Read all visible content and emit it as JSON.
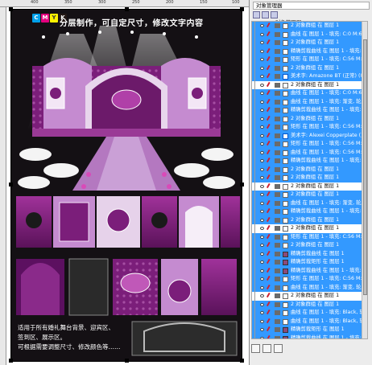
{
  "ruler": {
    "ticks": [
      "400",
      "350",
      "300",
      "250",
      "200",
      "150",
      "100"
    ]
  },
  "canvas": {
    "header_title": "分层制作，可自定尺寸，修改文字内容",
    "cmyk_letters": [
      "C",
      "M",
      "Y",
      "K"
    ],
    "cmyk_colors": [
      "#00a0e9",
      "#e4007f",
      "#fff100",
      "#231815"
    ],
    "info_lines": [
      "适用于所有婚礼舞台背景、迎宾区、",
      "签到区、展示区。",
      "可根据需要调整尺寸、修改颜色等……"
    ],
    "accent_purple": "#7b1e7a",
    "accent_lavender": "#c58bd0"
  },
  "docker": {
    "tab_label": "对象管理器",
    "title": "对象管理器",
    "rows": [
      {
        "label": "2 对象群组 在 图层 1",
        "icon": "obj",
        "sel": true
      },
      {
        "label": "曲线 在 图层 1 - 填充: C:0 M:60",
        "icon": "obj",
        "sel": true
      },
      {
        "label": "2 对象群组 在 图层 1",
        "icon": "obj",
        "sel": true
      },
      {
        "label": "精确剪裁曲线 在 图层 1 - 填充: White, 轮",
        "icon": "obj",
        "sel": true
      },
      {
        "label": "矩形 在 图层 1 - 填充: C:56 M:98",
        "icon": "obj",
        "sel": true
      },
      {
        "label": "2 对象群组 在 图层 1",
        "icon": "obj",
        "sel": true
      },
      {
        "label": "美术字: Amazone BT (正常) (US",
        "icon": "text",
        "sel": true
      },
      {
        "label": "2 对象群组 在 图层 1",
        "icon": "obj",
        "sel": false
      },
      {
        "label": "曲线 在 图层 1 - 填充: C:0 M:60",
        "icon": "obj",
        "sel": true
      },
      {
        "label": "曲线 在 图层 1 - 填充: 渐变, 轮廓",
        "icon": "obj",
        "sel": true
      },
      {
        "label": "精确剪裁曲线 在 图层 1 - 填充: 渐变, 轮廓",
        "icon": "obj",
        "sel": true
      },
      {
        "label": "2 对象群组 在 图层 1",
        "icon": "obj",
        "sel": true
      },
      {
        "label": "矩形 在 图层 1 - 填充: C:56 M:98",
        "icon": "obj",
        "sel": true
      },
      {
        "label": "美术字: Alexei Copperplate (正常",
        "icon": "text",
        "sel": true
      },
      {
        "label": "矩形 在 图层 1 - 填充: C:56 M:98",
        "icon": "obj",
        "sel": true
      },
      {
        "label": "曲线 在 图层 1 - 填充: C:56 M:98",
        "icon": "obj",
        "sel": true
      },
      {
        "label": "精确剪裁曲线 在 图层 1 - 填充: 渐变, 轮廓",
        "icon": "obj",
        "sel": true
      },
      {
        "label": "2 对象群组 在 图层 1",
        "icon": "obj",
        "sel": true
      },
      {
        "label": "2 对象群组 在 图层 1",
        "icon": "obj",
        "sel": true
      },
      {
        "label": "2 对象群组 在 图层 1",
        "icon": "obj",
        "sel": false
      },
      {
        "label": "2 对象群组 在 图层 1",
        "icon": "obj",
        "sel": true
      },
      {
        "label": "曲线 在 图层 1 - 填充: 渐变, 轮廓",
        "icon": "obj",
        "sel": true
      },
      {
        "label": "精确剪裁曲线 在 图层 1 - 填充: 渐变, 轮廓",
        "icon": "obj",
        "sel": true
      },
      {
        "label": "2 对象群组 在 图层 1",
        "icon": "obj",
        "sel": true
      },
      {
        "label": "2 对象群组 在 图层 1",
        "icon": "obj",
        "sel": false
      },
      {
        "label": "矩形 在 图层 1 - 填充: C:56 M:98",
        "icon": "obj",
        "sel": true
      },
      {
        "label": "2 对象群组 在 图层 1",
        "icon": "obj",
        "sel": true
      },
      {
        "label": "精确剪裁曲线 在 图层 1",
        "icon": "pic",
        "sel": true
      },
      {
        "label": "精确剪裁矩形 在 图层 1",
        "icon": "pic",
        "sel": true
      },
      {
        "label": "精确剪裁曲线 在 图层 1 - 填充: 渐变, 轮",
        "icon": "pic",
        "sel": true
      },
      {
        "label": "矩形 在 图层 1 - 填充: C:56 M:98",
        "icon": "obj",
        "sel": true
      },
      {
        "label": "曲线 在 图层 1 - 填充: 渐变, 轮廓",
        "icon": "obj",
        "sel": true
      },
      {
        "label": "2 对象群组 在 图层 1",
        "icon": "obj",
        "sel": false
      },
      {
        "label": "2 对象群组 在 图层 1",
        "icon": "obj",
        "sel": true
      },
      {
        "label": "曲线 在 图层 1 - 填充: Black, 轮廓",
        "icon": "obj",
        "sel": true
      },
      {
        "label": "曲线 在 图层 1 - 填充: Black, 轮廓",
        "icon": "obj",
        "sel": true
      },
      {
        "label": "精确剪裁矩形 在 图层 1",
        "icon": "pic",
        "sel": true
      },
      {
        "label": "精确剪裁曲线 在 图层 1 - 填充: 渐变, 轮",
        "icon": "pic",
        "sel": true
      }
    ]
  }
}
